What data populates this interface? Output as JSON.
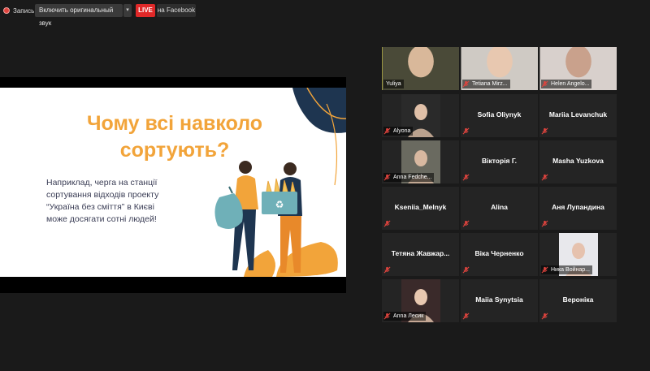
{
  "toolbar": {
    "record_label": "Запись",
    "sound_label": "Включить оригинальный звук",
    "live_label": "LIVE",
    "facebook_label": "на Facebook"
  },
  "slide": {
    "title_line1": "Чому всі навколо",
    "title_line2": "сортують?",
    "body_line1": "Наприклад, черга на станції",
    "body_line2": "сортування відходів проекту",
    "body_line3": "“Україна без сміття” в Києві",
    "body_line4": "може досягати сотні людей!"
  },
  "participants": [
    {
      "name": "Yuliya",
      "video": true,
      "muted": false,
      "active": true
    },
    {
      "name": "Tetiana Mirz...",
      "video": true,
      "muted": true
    },
    {
      "name": "Helen Angelo...",
      "video": true,
      "muted": true
    },
    {
      "name": "Alyona",
      "video": true,
      "muted": true
    },
    {
      "name": "Sofia Oliynyk",
      "video": false,
      "muted": true
    },
    {
      "name": "Mariia Levanchuk",
      "video": false,
      "muted": true
    },
    {
      "name": "Anna Fedche...",
      "video": true,
      "muted": true
    },
    {
      "name": "Вікторія Г.",
      "video": false,
      "muted": true
    },
    {
      "name": "Masha Yuzkova",
      "video": false,
      "muted": true
    },
    {
      "name": "Kseniia_Melnyk",
      "video": false,
      "muted": true
    },
    {
      "name": "Alina",
      "video": false,
      "muted": true
    },
    {
      "name": "Аня Лупандина",
      "video": false,
      "muted": true
    },
    {
      "name": "Тетяна Жавжар...",
      "video": false,
      "muted": true
    },
    {
      "name": "Віка Черненко",
      "video": false,
      "muted": true
    },
    {
      "name": "Ника Войнар...",
      "video": true,
      "muted": true
    },
    {
      "name": "Anna Лесик",
      "video": true,
      "muted": true
    },
    {
      "name": "Maiia Synytsia",
      "video": false,
      "muted": true
    },
    {
      "name": "Вероніка",
      "video": false,
      "muted": true
    }
  ],
  "colors": {
    "accent_orange": "#f2a43a",
    "live_red": "#e02828",
    "active_speaker": "#e8e04a",
    "mute_red": "#e0443e"
  }
}
